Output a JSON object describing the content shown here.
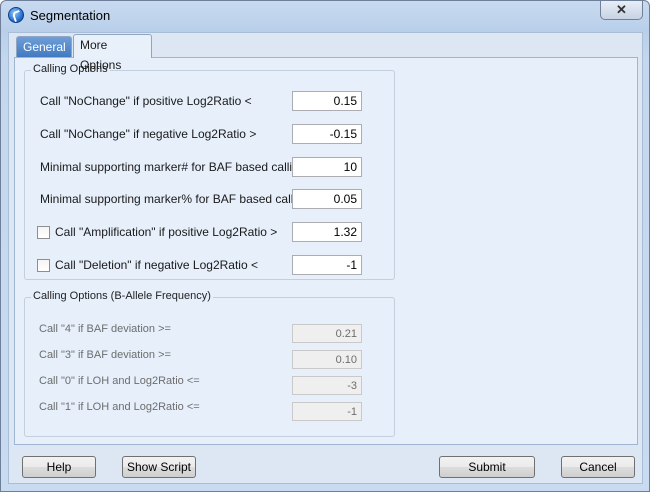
{
  "window": {
    "title": "Segmentation",
    "close_glyph": "✕"
  },
  "tabs": [
    {
      "label": "General",
      "selected": false
    },
    {
      "label": "More Options",
      "selected": true
    }
  ],
  "calling_options": {
    "legend": "Calling Options",
    "rows": [
      {
        "label": "Call \"NoChange\" if positive Log2Ratio <",
        "value": "0.15",
        "checkbox": false
      },
      {
        "label": "Call \"NoChange\" if negative Log2Ratio >",
        "value": "-0.15",
        "checkbox": false
      },
      {
        "label": "Minimal supporting marker# for BAF based calling",
        "value": "10",
        "checkbox": false
      },
      {
        "label": "Minimal supporting marker% for BAF based calling",
        "value": "0.05",
        "checkbox": false
      },
      {
        "label": "Call \"Amplification\" if positive Log2Ratio >",
        "value": "1.32",
        "checkbox": true,
        "checked": false
      },
      {
        "label": "Call \"Deletion\" if negative Log2Ratio <",
        "value": "-1",
        "checkbox": true,
        "checked": false
      }
    ]
  },
  "baf_options": {
    "legend": "Calling Options (B-Allele Frequency)",
    "rows": [
      {
        "label": "Call \"4\" if BAF deviation >=",
        "value": "0.21"
      },
      {
        "label": "Call \"3\" if BAF deviation >=",
        "value": "0.10"
      },
      {
        "label": "Call \"0\" if LOH and Log2Ratio <=",
        "value": "-3"
      },
      {
        "label": "Call \"1\" if LOH and Log2Ratio <=",
        "value": "-1"
      }
    ]
  },
  "buttons": {
    "help": "Help",
    "show_script": "Show Script",
    "submit": "Submit",
    "cancel": "Cancel"
  }
}
